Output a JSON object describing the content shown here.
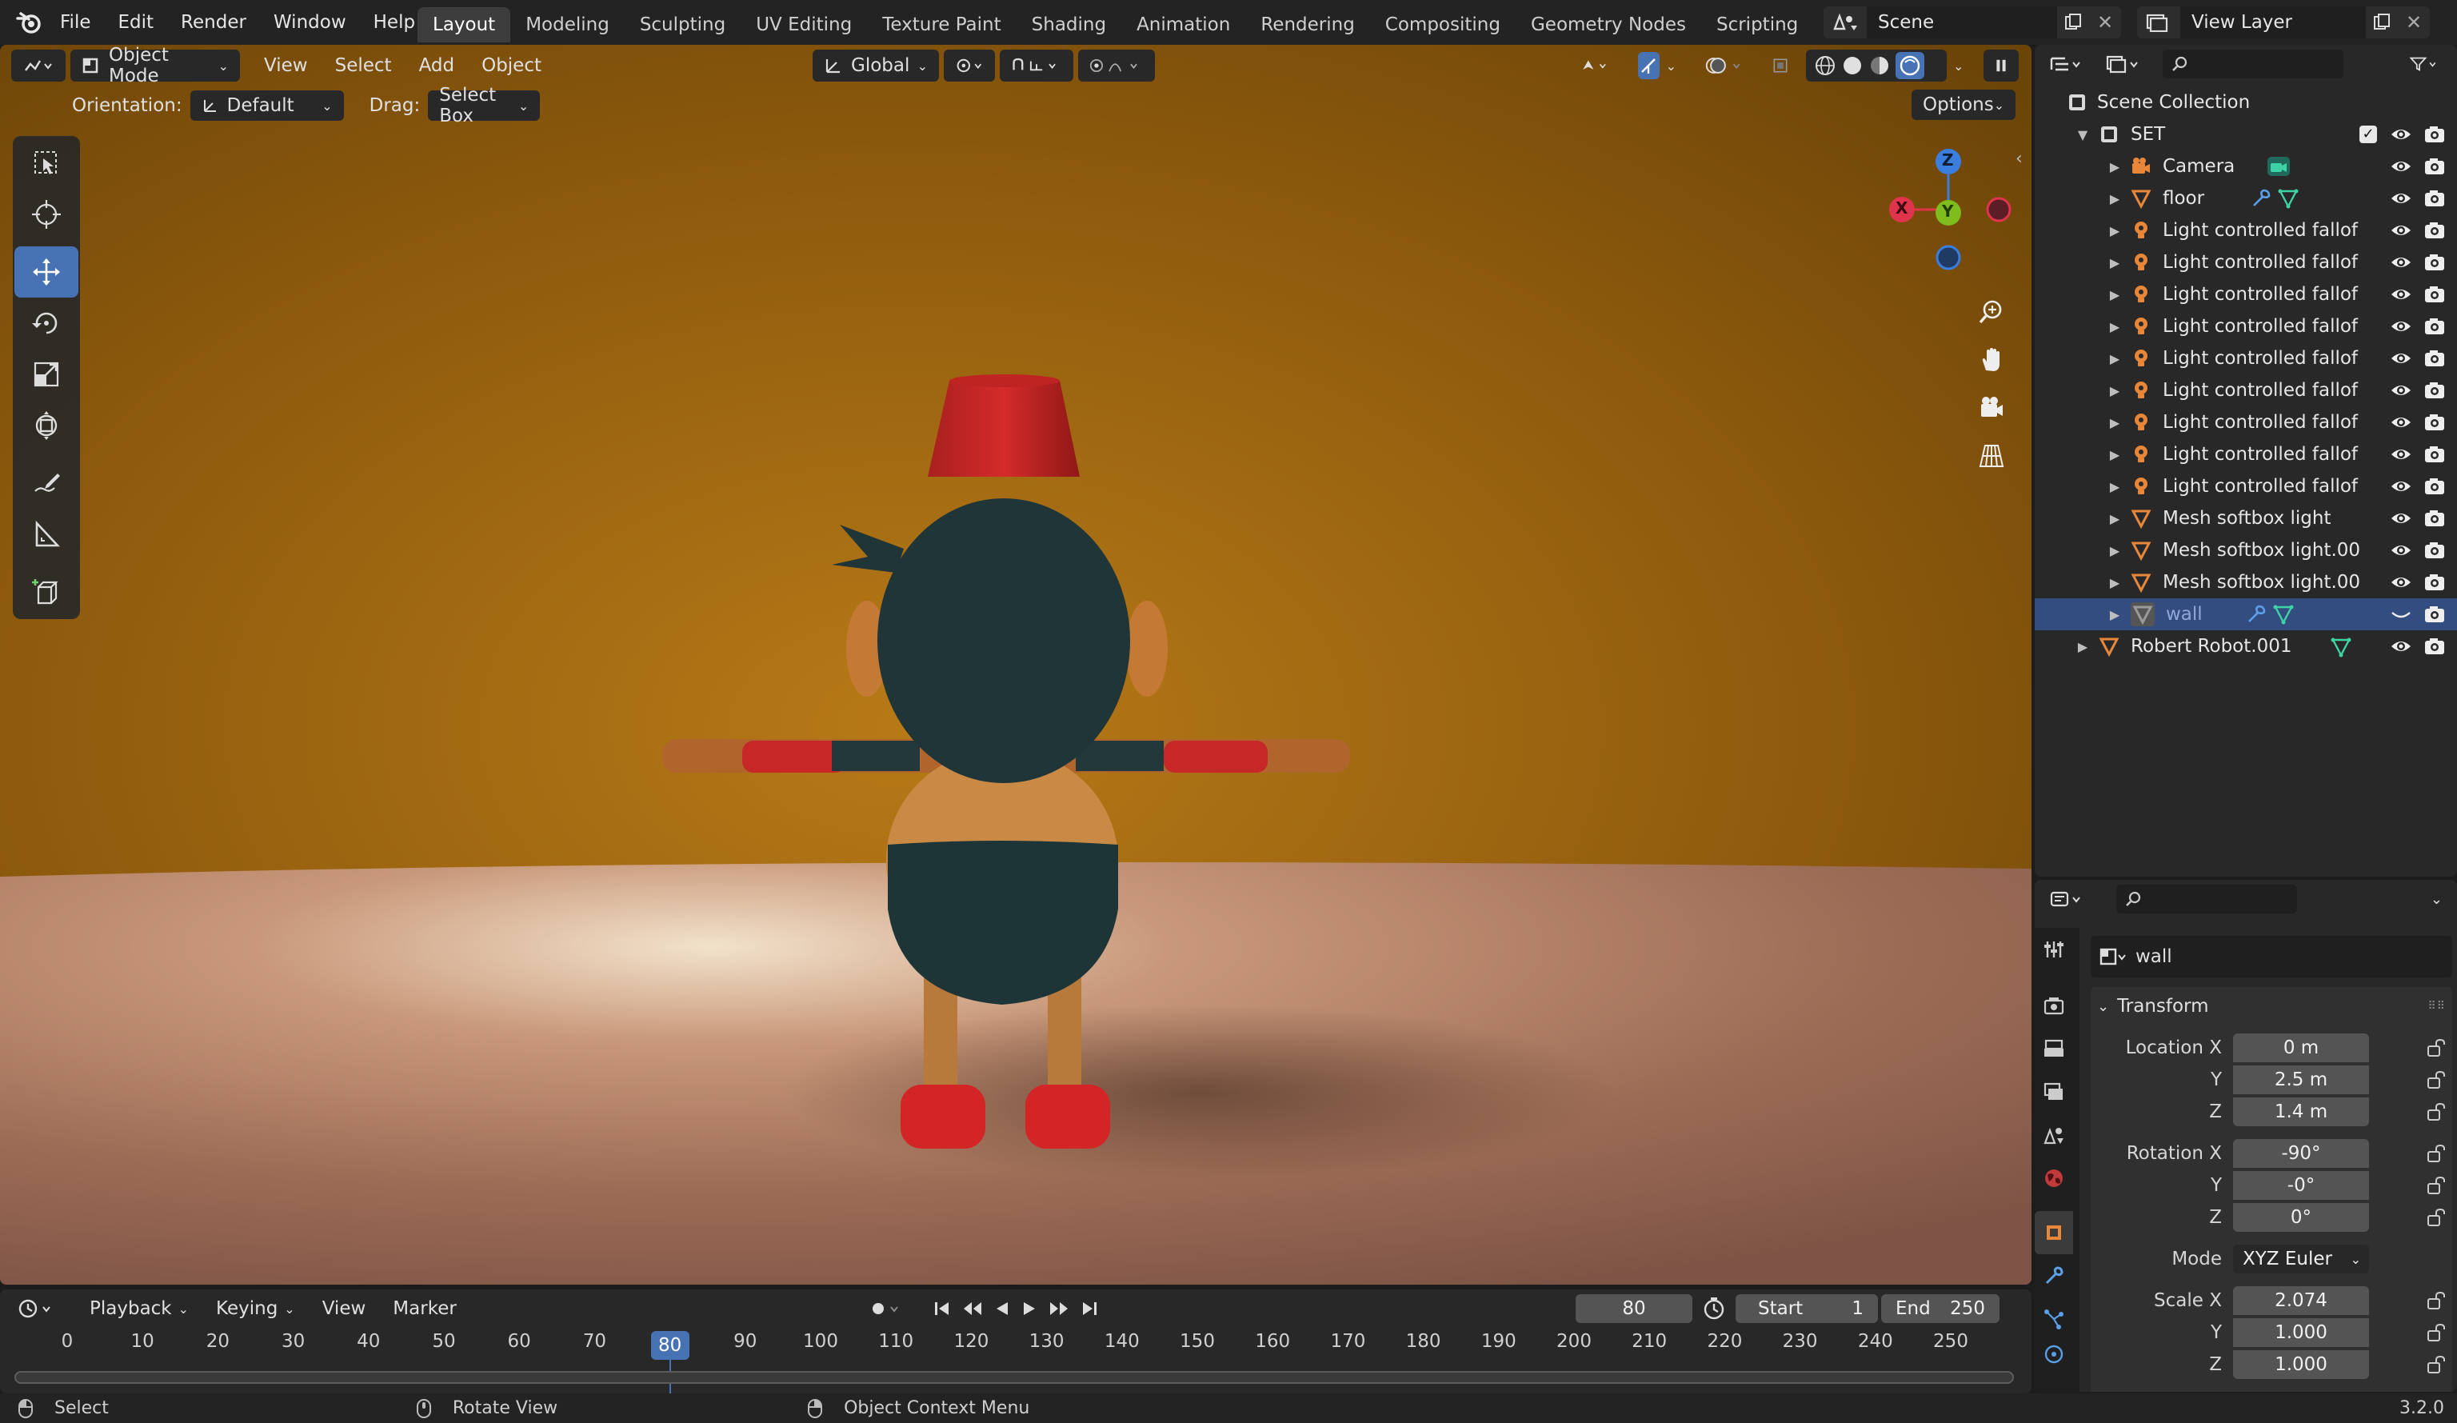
{
  "app": {
    "version": "3.2.0"
  },
  "menu": [
    "File",
    "Edit",
    "Render",
    "Window",
    "Help"
  ],
  "workspaces": [
    "Layout",
    "Modeling",
    "Sculpting",
    "UV Editing",
    "Texture Paint",
    "Shading",
    "Animation",
    "Rendering",
    "Compositing",
    "Geometry Nodes",
    "Scripting"
  ],
  "active_workspace": "Layout",
  "scene_field": "Scene",
  "view_layer_field": "View Layer",
  "viewport_header": {
    "mode": "Object Mode",
    "menus": [
      "View",
      "Select",
      "Add",
      "Object"
    ],
    "transform_orientation": "Global",
    "orientation_label": "Orientation:",
    "orientation_value": "Default",
    "drag_label": "Drag:",
    "drag_value": "Select Box",
    "options_label": "Options"
  },
  "gizmo": {
    "x": "X",
    "y": "Y",
    "z": "Z"
  },
  "outliner": {
    "scene_collection": "Scene Collection",
    "collection": "SET",
    "items": [
      {
        "name": "Camera",
        "icon": "camera-icon"
      },
      {
        "name": "floor",
        "icon": "mesh-icon"
      },
      {
        "name": "Light controlled fallof",
        "icon": "light-icon"
      },
      {
        "name": "Light controlled fallof",
        "icon": "light-icon"
      },
      {
        "name": "Light controlled fallof",
        "icon": "light-icon"
      },
      {
        "name": "Light controlled fallof",
        "icon": "light-icon"
      },
      {
        "name": "Light controlled fallof",
        "icon": "light-icon"
      },
      {
        "name": "Light controlled fallof",
        "icon": "light-icon"
      },
      {
        "name": "Light controlled fallof",
        "icon": "light-icon"
      },
      {
        "name": "Light controlled fallof",
        "icon": "light-icon"
      },
      {
        "name": "Light controlled fallof",
        "icon": "light-icon"
      },
      {
        "name": "Mesh softbox light",
        "icon": "mesh-icon"
      },
      {
        "name": "Mesh softbox light.00",
        "icon": "mesh-icon"
      },
      {
        "name": "Mesh softbox light.00",
        "icon": "mesh-icon"
      },
      {
        "name": "wall",
        "icon": "mesh-icon",
        "selected": true
      }
    ],
    "root_object": "Robert Robot.001"
  },
  "properties": {
    "object_name": "wall",
    "panel_title": "Transform",
    "location_label": "Location X",
    "location": [
      "0 m",
      "2.5 m",
      "1.4 m"
    ],
    "rotation_label": "Rotation X",
    "rotation": [
      "-90°",
      "-0°",
      "0°"
    ],
    "mode_label": "Mode",
    "mode_value": "XYZ Euler",
    "scale_label": "Scale X",
    "scale": [
      "2.074",
      "1.000",
      "1.000"
    ],
    "y_label": "Y",
    "z_label": "Z"
  },
  "timeline": {
    "menus": [
      "Playback",
      "Keying",
      "View",
      "Marker"
    ],
    "current_frame": "80",
    "start_label": "Start",
    "start_value": "1",
    "end_label": "End",
    "end_value": "250",
    "ticks": [
      "0",
      "10",
      "20",
      "30",
      "40",
      "50",
      "60",
      "70",
      "80",
      "90",
      "100",
      "110",
      "120",
      "130",
      "140",
      "150",
      "160",
      "170",
      "180",
      "190",
      "200",
      "210",
      "220",
      "230",
      "240",
      "250"
    ]
  },
  "status_bar": {
    "select": "Select",
    "rotate": "Rotate View",
    "context_menu": "Object Context Menu"
  },
  "colors": {
    "accent": "#4772b3",
    "selected_row": "#334d80",
    "axis_x": "#e0344c",
    "axis_y": "#7fbd1e",
    "axis_z": "#3a7ee0"
  }
}
